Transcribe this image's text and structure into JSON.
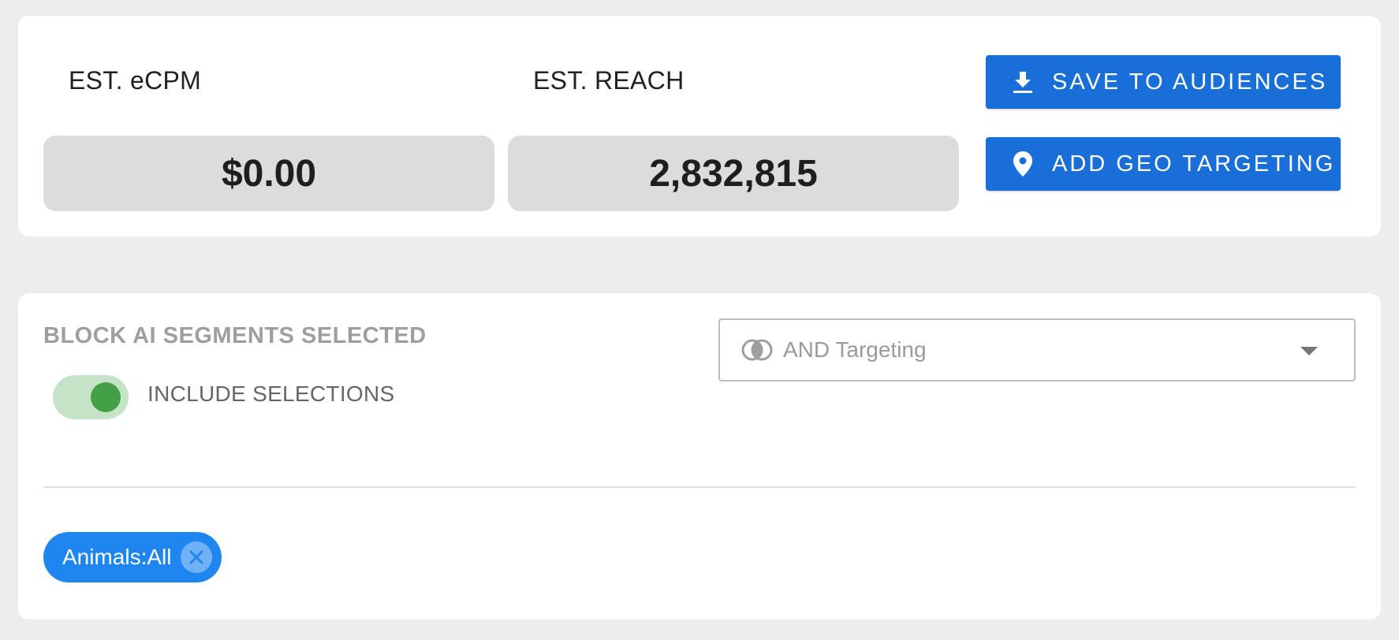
{
  "metrics": {
    "ecpm_label": "EST. eCPM",
    "ecpm_value": "$0.00",
    "reach_label": "EST. REACH",
    "reach_value": "2,832,815"
  },
  "actions": {
    "save_label": "SAVE TO AUDIENCES",
    "save_icon": "download-icon",
    "geo_label": "ADD GEO TARGETING",
    "geo_icon": "location-pin-icon"
  },
  "segments": {
    "title": "BLOCK AI SEGMENTS SELECTED",
    "toggle_label": "INCLUDE SELECTIONS",
    "toggle_on": true,
    "targeting_mode": "AND Targeting",
    "targeting_icon": "intersection-icon",
    "chips": [
      {
        "label": "Animals:All",
        "remove_icon": "close-circle-icon"
      }
    ]
  },
  "colors": {
    "primary": "#1a6ed8",
    "chip": "#1f86f0",
    "toggle_track": "#c5e3c6",
    "toggle_knob": "#43a047",
    "background": "#ededed"
  }
}
